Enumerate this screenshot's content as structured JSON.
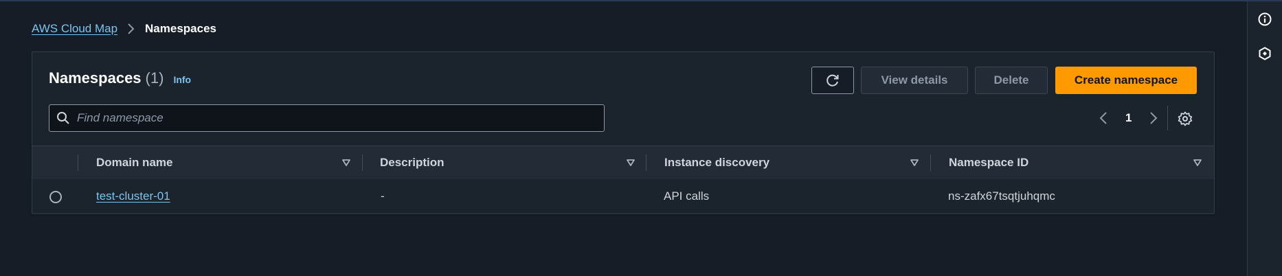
{
  "breadcrumb": {
    "root": "AWS Cloud Map",
    "current": "Namespaces"
  },
  "panel": {
    "title": "Namespaces",
    "count": "(1)",
    "info": "Info"
  },
  "toolbar": {
    "refresh_icon": "refresh-icon",
    "view_details": "View details",
    "delete": "Delete",
    "create": "Create namespace"
  },
  "search": {
    "placeholder": "Find namespace",
    "value": ""
  },
  "pagination": {
    "current_page": "1"
  },
  "table": {
    "columns": [
      "Domain name",
      "Description",
      "Instance discovery",
      "Namespace ID"
    ],
    "rows": [
      {
        "domain_name": "test-cluster-01",
        "description": "-",
        "instance_discovery": "API calls",
        "namespace_id": "ns-zafx67tsqtjuhqmc"
      }
    ]
  },
  "colors": {
    "background": "#161d26",
    "panel": "#1b232d",
    "primary": "#ff9900",
    "link": "#7cc4f0"
  }
}
